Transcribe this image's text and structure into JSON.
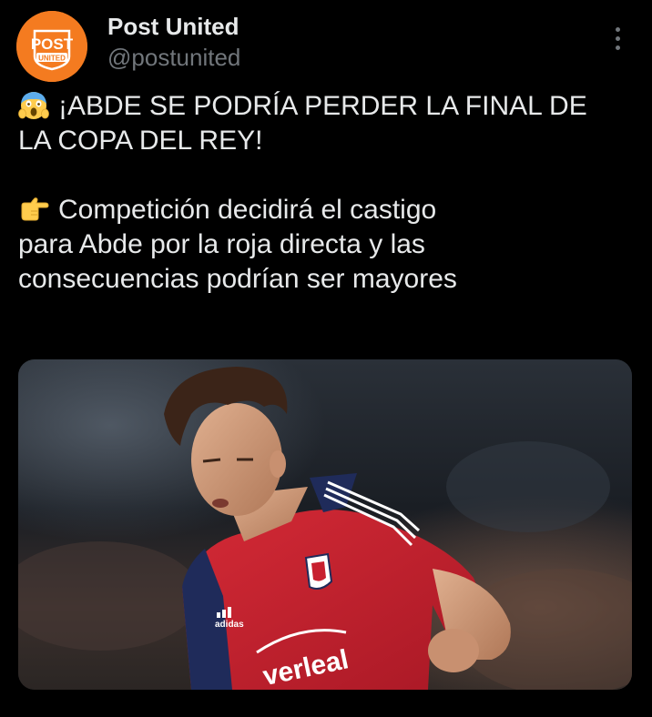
{
  "author": {
    "display_name": "Post United",
    "handle": "@postunited",
    "avatar_logo_text_top": "POST",
    "avatar_logo_text_bottom": "UNITED",
    "avatar_color": "#f47b20"
  },
  "menu": {
    "icon": "more-vertical-icon"
  },
  "tweet": {
    "line1_emoji": "scream-emoji",
    "line1_text": "¡ABDE SE PODRÍA PERDER LA FINAL DE",
    "line2_text": "LA COPA DEL REY!",
    "line3_emoji": "pointing-right-emoji",
    "line3_text": "Competición decidirá el castigo",
    "line4_text": "para Abde por la roja directa y las",
    "line5_text": "consecuencias podrían ser mayores"
  },
  "media": {
    "jersey_sponsor": "verleal",
    "jersey_brand": "adidas",
    "jersey_color": "#c8202f"
  }
}
